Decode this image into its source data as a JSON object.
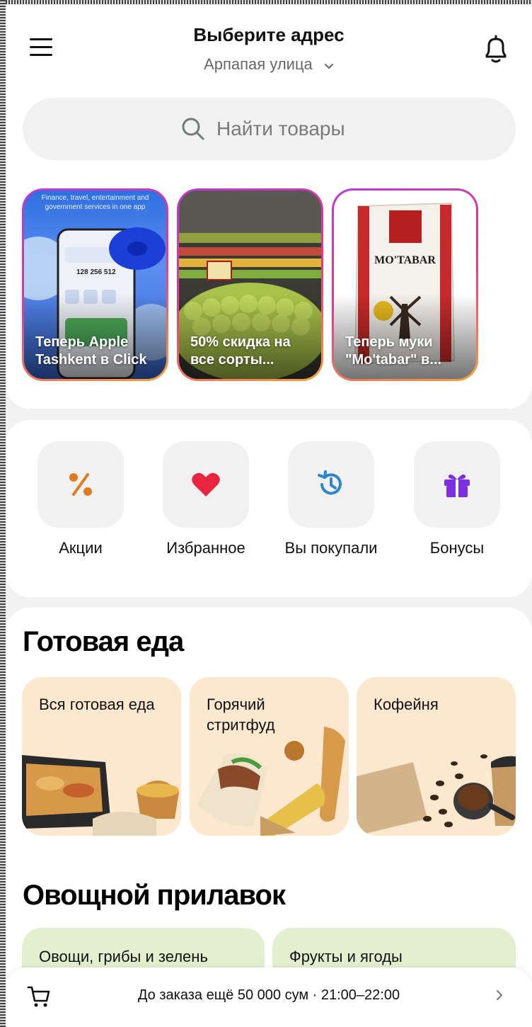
{
  "header": {
    "title": "Выберите адрес",
    "address": "Арпапая улица"
  },
  "search": {
    "placeholder": "Найти товары"
  },
  "stories": [
    {
      "label": "Теперь Apple Tashkent в Click",
      "overlay": "Finance, travel, entertainment and government services in one app",
      "balance": "128 256 512"
    },
    {
      "label": "50% скидка на все сорты..."
    },
    {
      "label": "Теперь муки \"Mo'tabar\" в...",
      "brand": "MO'TABAR"
    }
  ],
  "quick_actions": [
    {
      "label": "Акции",
      "icon": "percent-icon",
      "color": "#e07a1f"
    },
    {
      "label": "Избранное",
      "icon": "heart-icon",
      "color": "#e8243f"
    },
    {
      "label": "Вы покупали",
      "icon": "history-icon",
      "color": "#2e86c9"
    },
    {
      "label": "Бонусы",
      "icon": "gift-icon",
      "color": "#7b2fe0"
    }
  ],
  "ready_food": {
    "title": "Готовая еда",
    "cards": [
      "Вся готовая еда",
      "Горячий стритфуд",
      "Кофейня"
    ]
  },
  "veg": {
    "title": "Овощной прилавок",
    "cards": [
      "Овощи, грибы и зелень",
      "Фрукты и ягоды"
    ]
  },
  "bottom_bar": {
    "text": "До заказа ещё 50 000 сум · 21:00–22:00"
  }
}
